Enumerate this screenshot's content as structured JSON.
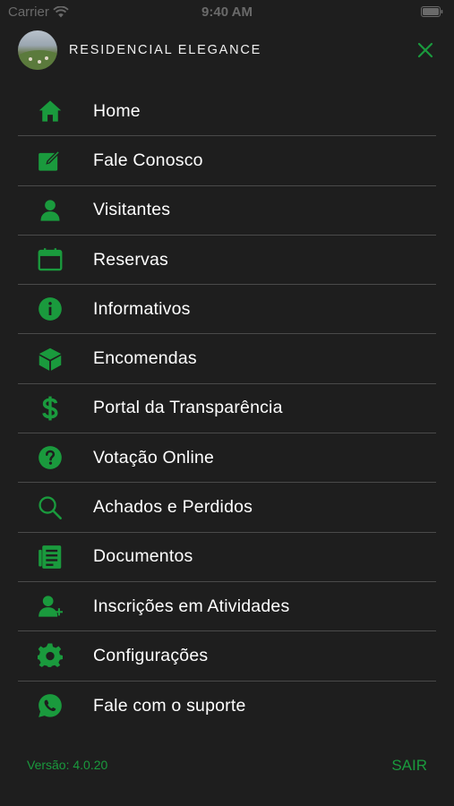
{
  "status_bar": {
    "carrier": "Carrier",
    "time": "9:40 AM"
  },
  "header": {
    "condo_name": "RESIDENCIAL ELEGANCE"
  },
  "colors": {
    "accent": "#1a9a3d",
    "background": "#1e1e1e",
    "divider": "#4a4a4a"
  },
  "menu": {
    "items": [
      {
        "label": "Home",
        "icon": "home-icon"
      },
      {
        "label": "Fale Conosco",
        "icon": "edit-icon"
      },
      {
        "label": "Visitantes",
        "icon": "person-icon"
      },
      {
        "label": "Reservas",
        "icon": "calendar-icon"
      },
      {
        "label": "Informativos",
        "icon": "info-icon"
      },
      {
        "label": "Encomendas",
        "icon": "package-icon"
      },
      {
        "label": "Portal da Transparência",
        "icon": "dollar-icon"
      },
      {
        "label": "Votação Online",
        "icon": "question-icon"
      },
      {
        "label": "Achados e Perdidos",
        "icon": "search-icon"
      },
      {
        "label": "Documentos",
        "icon": "document-icon"
      },
      {
        "label": "Inscrições em Atividades",
        "icon": "person-add-icon"
      },
      {
        "label": "Configurações",
        "icon": "gear-icon"
      },
      {
        "label": "Fale com o suporte",
        "icon": "whatsapp-icon"
      }
    ]
  },
  "footer": {
    "version": "Versão: 4.0.20",
    "logout": "SAIR"
  }
}
